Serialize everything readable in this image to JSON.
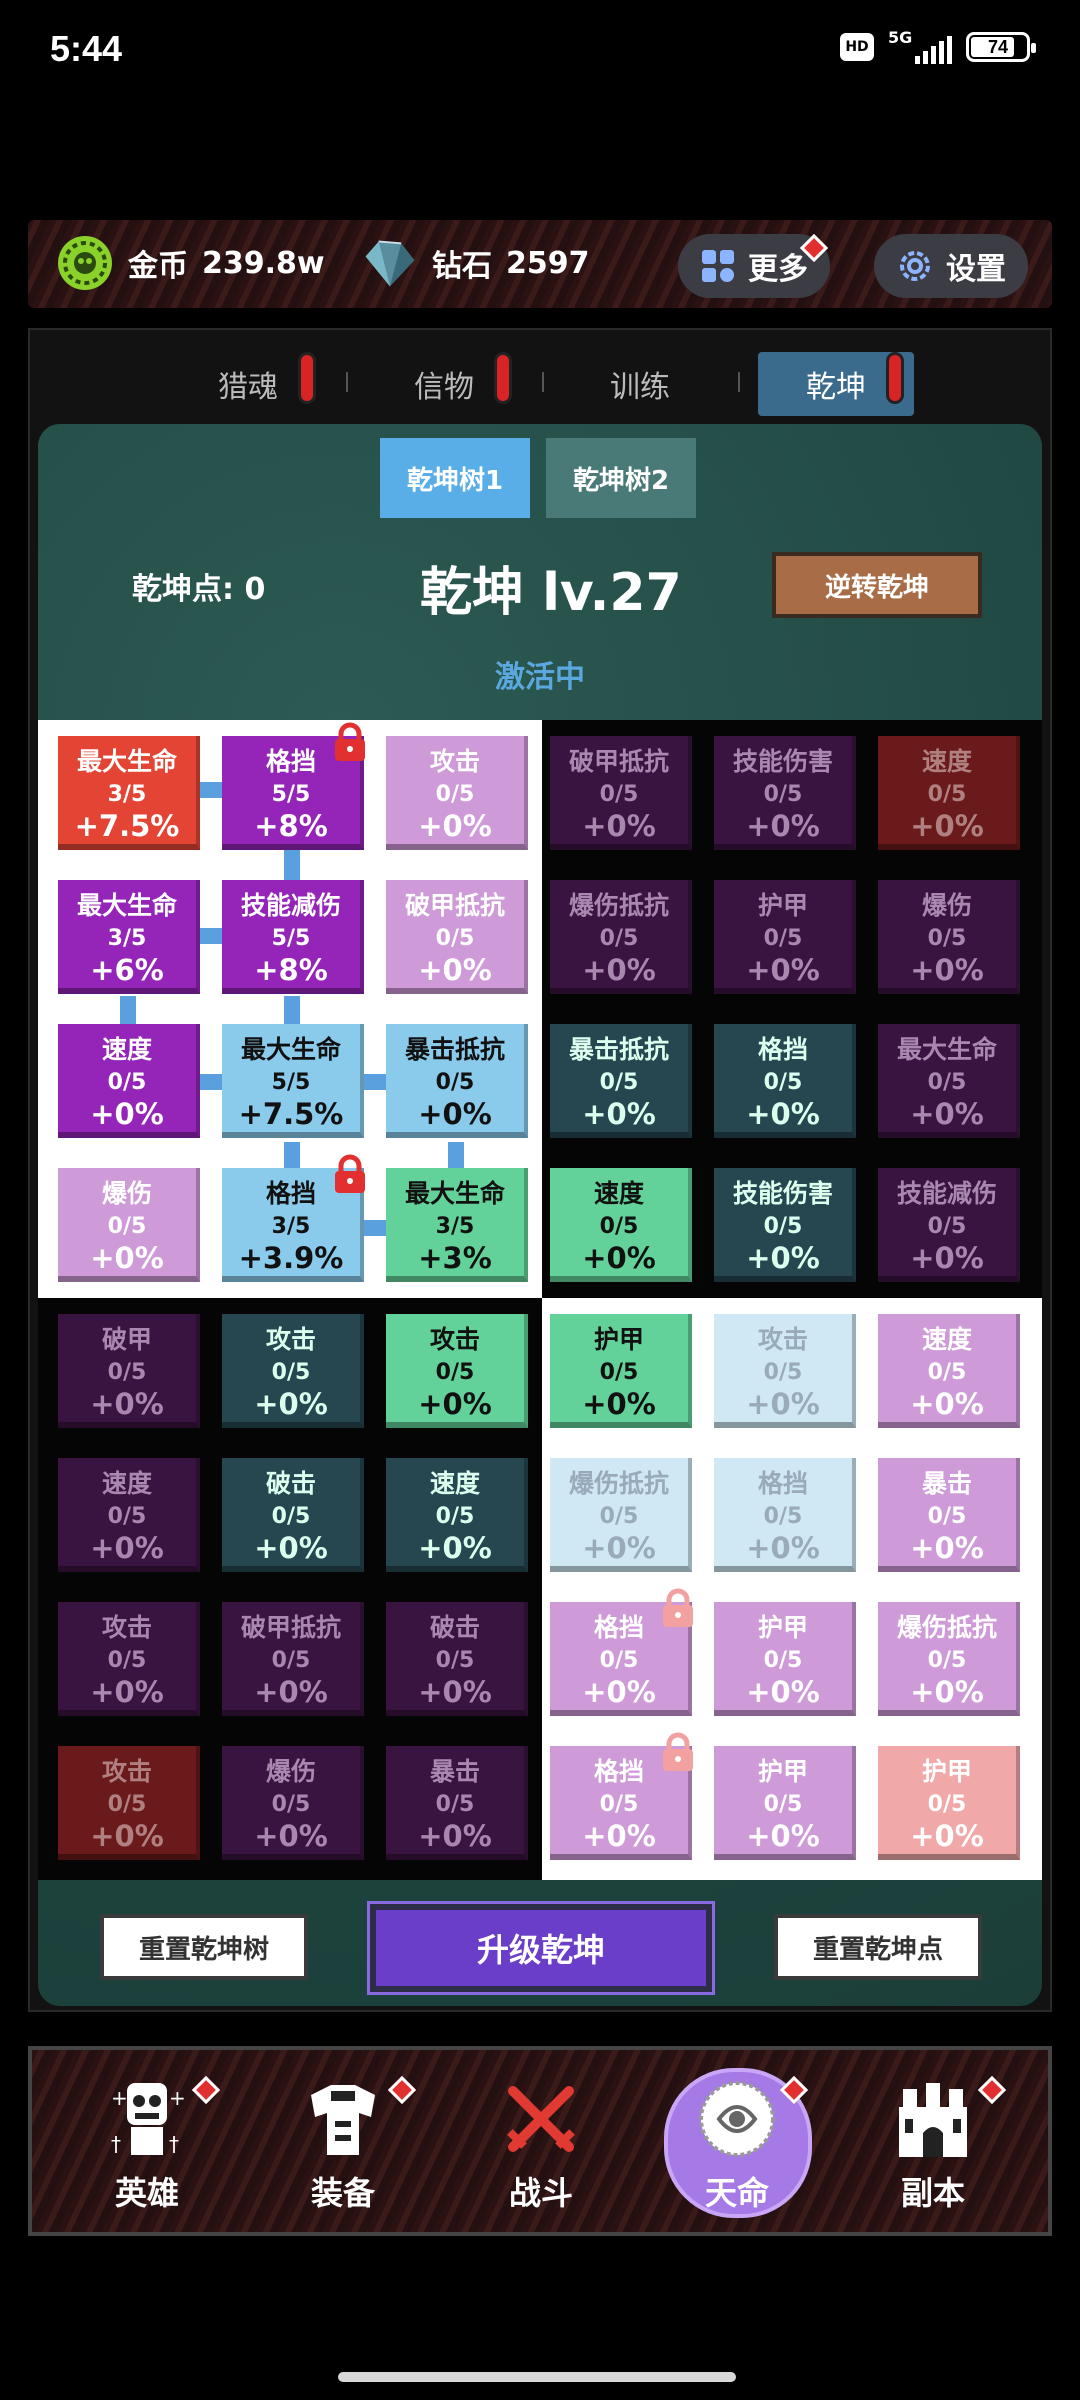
{
  "status": {
    "time": "5:44",
    "hd": "HD",
    "network": "5G",
    "battery": "74"
  },
  "currency": {
    "gold_label": "金币",
    "gold_value": "239.8w",
    "diamond_label": "钻石",
    "diamond_value": "2597"
  },
  "header_buttons": {
    "more": "更多",
    "settings": "设置"
  },
  "tabs": [
    {
      "label": "猎魂",
      "alert": true
    },
    {
      "label": "信物",
      "alert": true
    },
    {
      "label": "训练",
      "alert": false
    },
    {
      "label": "乾坤",
      "alert": true,
      "active": true
    }
  ],
  "subtabs": [
    {
      "label": "乾坤树1",
      "active": true
    },
    {
      "label": "乾坤树2",
      "active": false
    }
  ],
  "points_label": "乾坤点: 0",
  "title": "乾坤 lv.27",
  "reverse_button": "逆转乾坤",
  "status_label": "激活中",
  "grid": [
    [
      {
        "name": "最大生命",
        "level": "3/5",
        "value": "+7.5%",
        "color": "#e44434",
        "text": "#fff"
      },
      {
        "name": "格挡",
        "level": "5/5",
        "value": "+8%",
        "color": "#9524b8",
        "text": "#fff",
        "lock": true
      },
      {
        "name": "攻击",
        "level": "0/5",
        "value": "+0%",
        "color": "#cf9ad8",
        "text": "#fff"
      },
      {
        "name": "破甲抵抗",
        "level": "0/5",
        "value": "+0%",
        "color": "#3a1440",
        "text": "#a888ae"
      },
      {
        "name": "技能伤害",
        "level": "0/5",
        "value": "+0%",
        "color": "#3a1440",
        "text": "#a888ae"
      },
      {
        "name": "速度",
        "level": "0/5",
        "value": "+0%",
        "color": "#6a1a1a",
        "text": "#b08080"
      }
    ],
    [
      {
        "name": "最大生命",
        "level": "3/5",
        "value": "+6%",
        "color": "#9524b8",
        "text": "#fff"
      },
      {
        "name": "技能减伤",
        "level": "5/5",
        "value": "+8%",
        "color": "#9524b8",
        "text": "#fff"
      },
      {
        "name": "破甲抵抗",
        "level": "0/5",
        "value": "+0%",
        "color": "#cf9ad8",
        "text": "#fff"
      },
      {
        "name": "爆伤抵抗",
        "level": "0/5",
        "value": "+0%",
        "color": "#3a1440",
        "text": "#a888ae"
      },
      {
        "name": "护甲",
        "level": "0/5",
        "value": "+0%",
        "color": "#3a1440",
        "text": "#a888ae"
      },
      {
        "name": "爆伤",
        "level": "0/5",
        "value": "+0%",
        "color": "#3a1440",
        "text": "#a888ae"
      }
    ],
    [
      {
        "name": "速度",
        "level": "0/5",
        "value": "+0%",
        "color": "#9524b8",
        "text": "#fff"
      },
      {
        "name": "最大生命",
        "level": "5/5",
        "value": "+7.5%",
        "color": "#8acbec",
        "text": "#111"
      },
      {
        "name": "暴击抵抗",
        "level": "0/5",
        "value": "+0%",
        "color": "#8acbec",
        "text": "#111"
      },
      {
        "name": "暴击抵抗",
        "level": "0/5",
        "value": "+0%",
        "color": "#264650",
        "text": "#dfe",
        "dim": false
      },
      {
        "name": "格挡",
        "level": "0/5",
        "value": "+0%",
        "color": "#264650",
        "text": "#dfe"
      },
      {
        "name": "最大生命",
        "level": "0/5",
        "value": "+0%",
        "color": "#3a1440",
        "text": "#a888ae"
      }
    ],
    [
      {
        "name": "爆伤",
        "level": "0/5",
        "value": "+0%",
        "color": "#cf9ad8",
        "text": "#fff"
      },
      {
        "name": "格挡",
        "level": "3/5",
        "value": "+3.9%",
        "color": "#8acbec",
        "text": "#111",
        "lock": true
      },
      {
        "name": "最大生命",
        "level": "3/5",
        "value": "+3%",
        "color": "#62d29a",
        "text": "#111"
      },
      {
        "name": "速度",
        "level": "0/5",
        "value": "+0%",
        "color": "#62d29a",
        "text": "#111"
      },
      {
        "name": "技能伤害",
        "level": "0/5",
        "value": "+0%",
        "color": "#264650",
        "text": "#dfe"
      },
      {
        "name": "技能减伤",
        "level": "0/5",
        "value": "+0%",
        "color": "#3a1440",
        "text": "#a888ae"
      }
    ],
    [
      {
        "name": "破甲",
        "level": "0/5",
        "value": "+0%",
        "color": "#3a1440",
        "text": "#a888ae"
      },
      {
        "name": "攻击",
        "level": "0/5",
        "value": "+0%",
        "color": "#264650",
        "text": "#dfe"
      },
      {
        "name": "攻击",
        "level": "0/5",
        "value": "+0%",
        "color": "#62d29a",
        "text": "#111"
      },
      {
        "name": "护甲",
        "level": "0/5",
        "value": "+0%",
        "color": "#62d29a",
        "text": "#111"
      },
      {
        "name": "攻击",
        "level": "0/5",
        "value": "+0%",
        "color": "#cfe8f4",
        "text": "#9ab"
      },
      {
        "name": "速度",
        "level": "0/5",
        "value": "+0%",
        "color": "#cf9ad8",
        "text": "#fff"
      }
    ],
    [
      {
        "name": "速度",
        "level": "0/5",
        "value": "+0%",
        "color": "#3a1440",
        "text": "#a888ae"
      },
      {
        "name": "破击",
        "level": "0/5",
        "value": "+0%",
        "color": "#264650",
        "text": "#dfe"
      },
      {
        "name": "速度",
        "level": "0/5",
        "value": "+0%",
        "color": "#264650",
        "text": "#dfe"
      },
      {
        "name": "爆伤抵抗",
        "level": "0/5",
        "value": "+0%",
        "color": "#cfe8f4",
        "text": "#9ab"
      },
      {
        "name": "格挡",
        "level": "0/5",
        "value": "+0%",
        "color": "#cfe8f4",
        "text": "#9ab"
      },
      {
        "name": "暴击",
        "level": "0/5",
        "value": "+0%",
        "color": "#cf9ad8",
        "text": "#fff"
      }
    ],
    [
      {
        "name": "攻击",
        "level": "0/5",
        "value": "+0%",
        "color": "#3a1440",
        "text": "#a888ae"
      },
      {
        "name": "破甲抵抗",
        "level": "0/5",
        "value": "+0%",
        "color": "#3a1440",
        "text": "#a888ae"
      },
      {
        "name": "破击",
        "level": "0/5",
        "value": "+0%",
        "color": "#3a1440",
        "text": "#a888ae"
      },
      {
        "name": "格挡",
        "level": "0/5",
        "value": "+0%",
        "color": "#cf9ad8",
        "text": "#fff",
        "lock": true,
        "lockfaint": true
      },
      {
        "name": "护甲",
        "level": "0/5",
        "value": "+0%",
        "color": "#cf9ad8",
        "text": "#fff"
      },
      {
        "name": "爆伤抵抗",
        "level": "0/5",
        "value": "+0%",
        "color": "#cf9ad8",
        "text": "#fff"
      }
    ],
    [
      {
        "name": "攻击",
        "level": "0/5",
        "value": "+0%",
        "color": "#6a1a1a",
        "text": "#b08080"
      },
      {
        "name": "爆伤",
        "level": "0/5",
        "value": "+0%",
        "color": "#3a1440",
        "text": "#a888ae"
      },
      {
        "name": "暴击",
        "level": "0/5",
        "value": "+0%",
        "color": "#3a1440",
        "text": "#a888ae"
      },
      {
        "name": "格挡",
        "level": "0/5",
        "value": "+0%",
        "color": "#cf9ad8",
        "text": "#fff",
        "lock": true,
        "lockfaint": true
      },
      {
        "name": "护甲",
        "level": "0/5",
        "value": "+0%",
        "color": "#cf9ad8",
        "text": "#fff"
      },
      {
        "name": "护甲",
        "level": "0/5",
        "value": "+0%",
        "color": "#f0a8a8",
        "text": "#fff"
      }
    ]
  ],
  "buttons": {
    "reset_tree": "重置乾坤树",
    "upgrade": "升级乾坤",
    "reset_points": "重置乾坤点"
  },
  "nav": [
    {
      "label": "英雄",
      "icon": "hero-icon",
      "alert": true
    },
    {
      "label": "装备",
      "icon": "equipment-icon",
      "alert": true
    },
    {
      "label": "战斗",
      "icon": "battle-icon",
      "alert": false
    },
    {
      "label": "天命",
      "icon": "destiny-icon",
      "alert": true,
      "active": true
    },
    {
      "label": "副本",
      "icon": "dungeon-icon",
      "alert": true
    }
  ],
  "colors": {
    "accent_blue": "#5aa8de",
    "upgrade_purple": "#6a3ec8",
    "alert_red": "#d82424"
  }
}
